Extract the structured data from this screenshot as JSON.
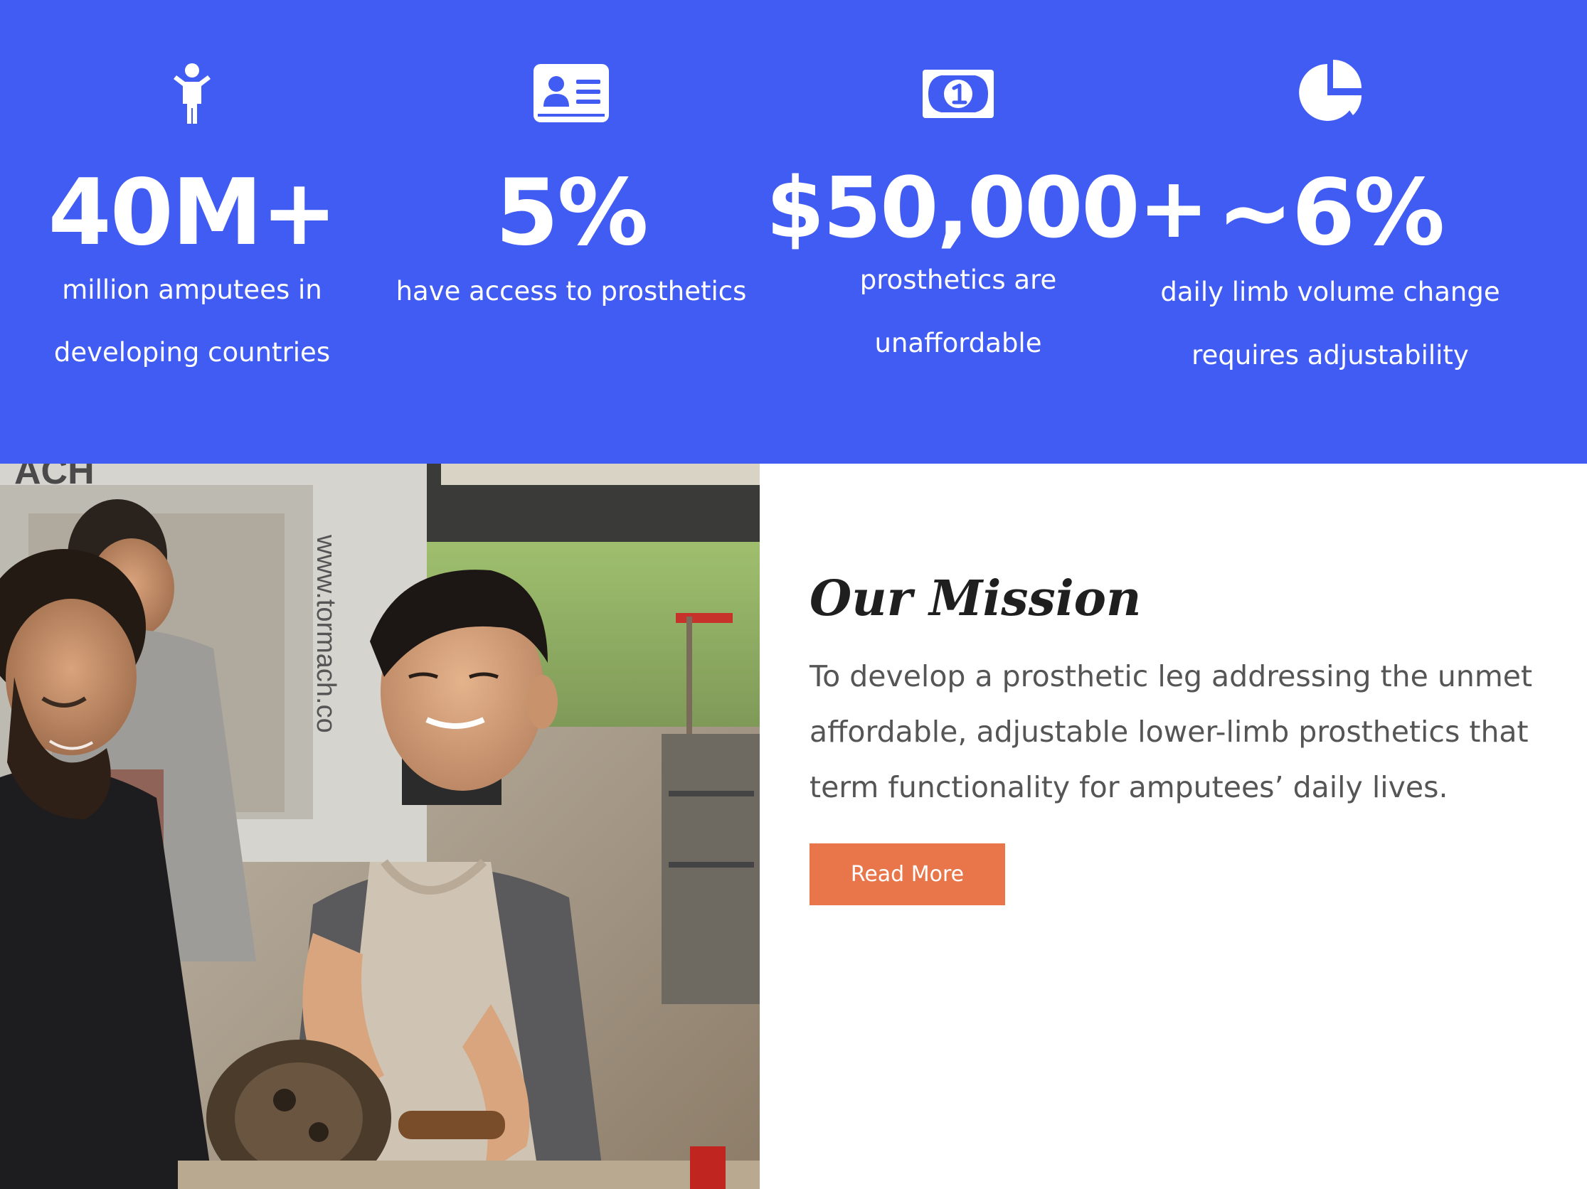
{
  "stats": [
    {
      "icon": "child-icon",
      "value": "40M+",
      "caption_lines": [
        "million amputees in",
        "developing countries"
      ]
    },
    {
      "icon": "id-card-icon",
      "value": "5%",
      "caption_lines": [
        "have access to prosthetics"
      ]
    },
    {
      "icon": "dollar-bill-icon",
      "value": "$50,000+",
      "caption_lines": [
        "prosthetics are",
        "unaffordable"
      ]
    },
    {
      "icon": "pie-chart-icon",
      "value": "~6%",
      "caption_lines": [
        "daily limb volume change",
        "requires adjustability"
      ]
    }
  ],
  "photo": {
    "subject": "students-working-at-lathe-photo",
    "signage_top": "ACH",
    "signage_side": "www.tormach.co"
  },
  "mission": {
    "title": "Our Mission",
    "text_lines": [
      "To develop a prosthetic leg addressing the unmet",
      "affordable, adjustable lower-limb prosthetics that",
      "term functionality for amputees’ daily lives."
    ],
    "button_label": "Read More"
  },
  "colors": {
    "stats_background": "#415cf2",
    "button": "#e8764a",
    "title_text": "#1f1f1f",
    "body_text": "#555555"
  }
}
